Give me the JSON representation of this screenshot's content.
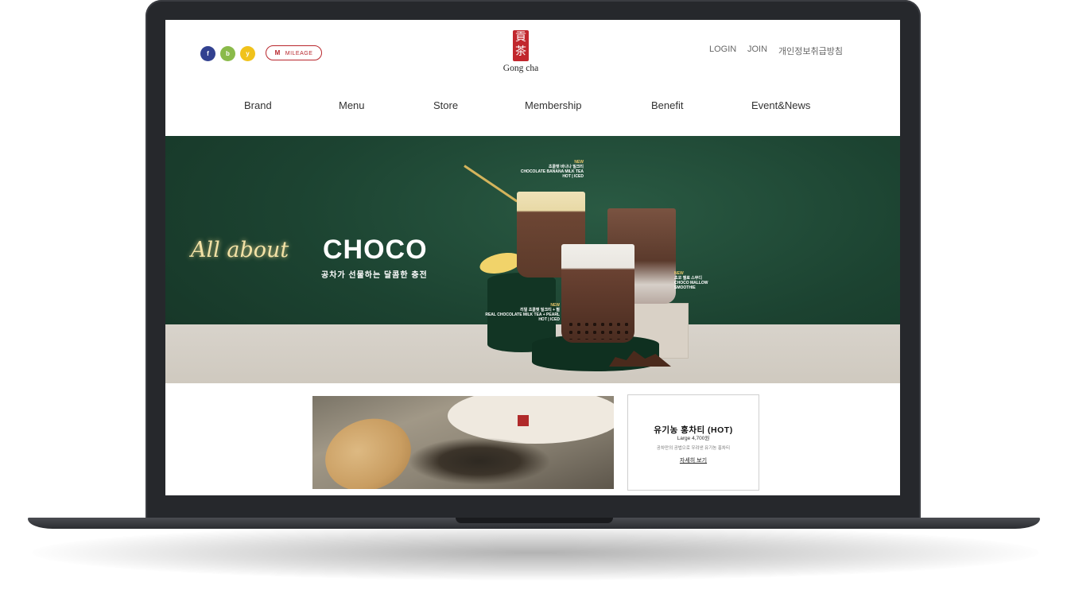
{
  "header": {
    "social": [
      {
        "label": "f",
        "icon": "facebook-icon",
        "color": "#324190"
      },
      {
        "label": "b",
        "icon": "blog-icon",
        "color": "#8aba4a"
      },
      {
        "label": "y",
        "icon": "youtube-icon",
        "color": "#f0c21b"
      }
    ],
    "mileage": {
      "mark": "M",
      "label": "MILEAGE",
      "color": "#b8262c"
    },
    "logo": {
      "seal": "貢茶",
      "text": "Gong cha",
      "color": "#c1272d"
    },
    "util": {
      "login": "LOGIN",
      "join": "JOIN",
      "privacy": "개인정보취급방침"
    }
  },
  "nav": [
    "Brand",
    "Menu",
    "Store",
    "Membership",
    "Benefit",
    "Event&News"
  ],
  "banner": {
    "script": "All about",
    "title": "CHOCO",
    "subtitle": "공차가 선물하는 달콤한 충전",
    "products": [
      {
        "new": "NEW",
        "ko": "초콜렛 바나나 밀크티",
        "en": "CHOCOLATE BANANA MILK TEA",
        "option": "HOT | ICED"
      },
      {
        "new": "NEW",
        "ko": "초코 멜로 스무디",
        "en": "CHOCO MALLOW SMOOTHIE",
        "option": ""
      },
      {
        "new": "NEW",
        "ko": "리얼 초콜렛 밀크티 + 펄",
        "en": "REAL CHOCOLATE MILK TEA + PEARL",
        "option": "HOT | ICED"
      }
    ],
    "colors": {
      "background": "#1c4331",
      "floor": "#d8d3cb"
    }
  },
  "product": {
    "name": "유기농 홍차티 (HOT)",
    "price": "Large 4,700원",
    "desc": "공차만의 공법으로 우려낸 유기농 홍차티",
    "more": "자세히 보기"
  }
}
